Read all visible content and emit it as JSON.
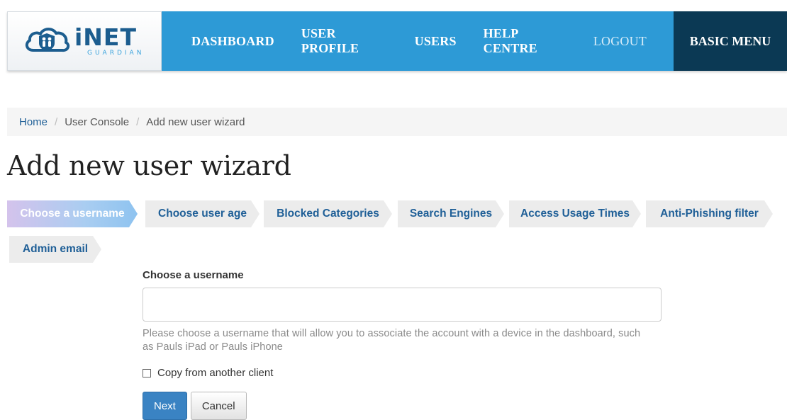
{
  "brand": {
    "logo_main": "iNET",
    "logo_sub": "GUARDIAN",
    "logo_icon": "cloud-family-shield-icon"
  },
  "nav": {
    "items": [
      {
        "label": "DASHBOARD"
      },
      {
        "label": "USER PROFILE"
      },
      {
        "label": "USERS"
      },
      {
        "label": "HELP CENTRE"
      },
      {
        "label": "LOGOUT"
      }
    ],
    "basic_menu": "BASIC MENU"
  },
  "breadcrumb": {
    "items": [
      "Home",
      "User Console",
      "Add new user wizard"
    ],
    "separator": "/"
  },
  "page": {
    "title": "Add new user wizard"
  },
  "wizard": {
    "steps": [
      {
        "label": "Choose a username",
        "active": true
      },
      {
        "label": "Choose user age",
        "active": false
      },
      {
        "label": "Blocked Categories",
        "active": false
      },
      {
        "label": "Search Engines",
        "active": false
      },
      {
        "label": "Access Usage Times",
        "active": false
      },
      {
        "label": "Anti-Phishing filter",
        "active": false
      },
      {
        "label": "Admin email",
        "active": false
      }
    ]
  },
  "form": {
    "username_label": "Choose a username",
    "username_value": "",
    "username_placeholder": "",
    "help_text": "Please choose a username that will allow you to associate the account with a device in the dashboard, such as Pauls iPad or Pauls iPhone",
    "copy_checkbox_label": "Copy from another client",
    "copy_checked": false,
    "next_label": "Next",
    "cancel_label": "Cancel"
  },
  "colors": {
    "nav_bg": "#2d9ad6",
    "basic_menu_bg": "#0b3954",
    "link": "#1f5f97",
    "primary_button": "#3a83c3"
  }
}
